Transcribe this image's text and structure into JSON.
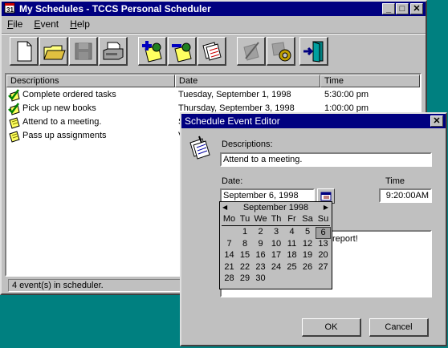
{
  "main_window": {
    "title": "My Schedules - TCCS Personal Scheduler",
    "menu": [
      {
        "label": "File",
        "key": "F",
        "rest": "ile"
      },
      {
        "label": "Event",
        "key": "E",
        "rest": "vent"
      },
      {
        "label": "Help",
        "key": "H",
        "rest": "elp"
      }
    ],
    "toolbar": [
      "new-file-icon",
      "open-folder-icon",
      "save-disk-icon",
      "print-icon",
      "add-event-icon",
      "remove-event-icon",
      "event-list-icon",
      "edit-icon",
      "settings-icon",
      "exit-door-icon"
    ],
    "columns": [
      "Descriptions",
      "Date",
      "Time"
    ],
    "rows": [
      {
        "description": "Complete ordered tasks",
        "date": "Tuesday, September 1, 1998",
        "time": "5:30:00 pm",
        "icon": "checked-note-icon"
      },
      {
        "description": "Pick up new books",
        "date": "Thursday, September 3, 1998",
        "time": "1:00:00 pm",
        "icon": "checked-note-icon"
      },
      {
        "description": "Attend to a meeting.",
        "date": "S",
        "time": "",
        "icon": "note-icon"
      },
      {
        "description": "Pass up assignments",
        "date": "V",
        "time": "",
        "icon": "note-icon"
      }
    ],
    "status": "4 event(s) in scheduler."
  },
  "dialog": {
    "title": "Schedule Event Editor",
    "descriptions_label": "Descriptions:",
    "descriptions_value": "Attend to a meeting.",
    "date_label": "Date:",
    "date_value": "September 6, 1998",
    "time_label": "Time",
    "time_value": "9:20:00AM",
    "notes_fragment": "report!",
    "ok_label": "OK",
    "cancel_label": "Cancel"
  },
  "calendar": {
    "month_label": "September 1998",
    "weekdays": [
      "Mo",
      "Tu",
      "We",
      "Th",
      "Fr",
      "Sa",
      "Su"
    ],
    "weeks": [
      [
        "",
        "1",
        "2",
        "3",
        "4",
        "5",
        "6"
      ],
      [
        "7",
        "8",
        "9",
        "10",
        "11",
        "12",
        "13"
      ],
      [
        "14",
        "15",
        "16",
        "17",
        "18",
        "19",
        "20"
      ],
      [
        "21",
        "22",
        "23",
        "24",
        "25",
        "26",
        "27"
      ],
      [
        "28",
        "29",
        "30",
        "",
        "",
        "",
        ""
      ]
    ],
    "selected": "6"
  }
}
